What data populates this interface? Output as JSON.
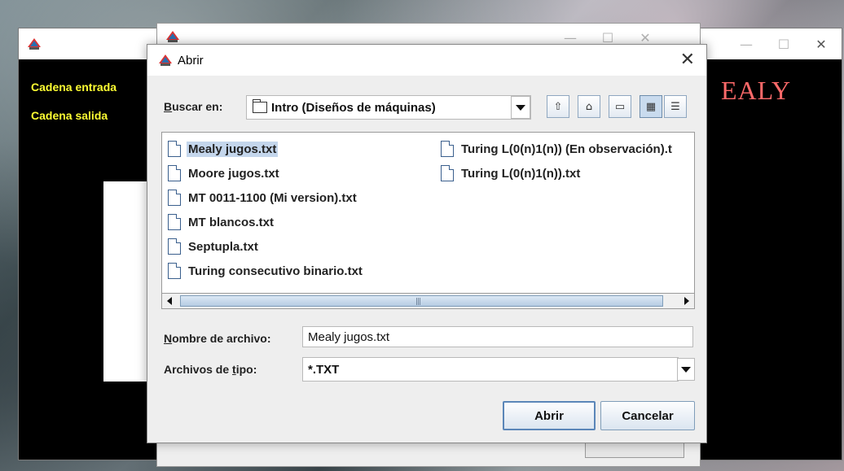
{
  "back_window": {
    "labels": {
      "input_string": "Cadena entrada",
      "output_string": "Cadena salida"
    },
    "title_art": "EALY",
    "controls": {
      "minimize": "—",
      "maximize": "☐",
      "close": "✕"
    }
  },
  "middle_window": {
    "controls": {
      "minimize": "—",
      "maximize": "☐",
      "close": "✕"
    }
  },
  "dialog": {
    "title": "Abrir",
    "close": "✕",
    "look_in": {
      "label_first": "B",
      "label_rest": "uscar en:",
      "value": "Intro (Diseños de máquinas)"
    },
    "toolbar": [
      "up-folder-icon",
      "home-icon",
      "new-folder-icon",
      "list-view-icon",
      "details-view-icon"
    ],
    "files_col1": [
      "Mealy jugos.txt",
      "Moore jugos.txt",
      "MT 0011-1100 (Mi version).txt",
      "MT blancos.txt",
      "Septupla.txt",
      "Turing consecutivo binario.txt"
    ],
    "files_col2": [
      "Turing L(0(n)1(n)) (En observación).t",
      "Turing L(0(n)1(n)).txt"
    ],
    "selected_file": "Mealy jugos.txt",
    "file_name": {
      "label_first": "N",
      "label_rest": "ombre de archivo:",
      "value": "Mealy jugos.txt"
    },
    "file_type": {
      "label_pre": "Archivos de ",
      "label_u": "t",
      "label_post": "ipo:",
      "value": "*.TXT"
    },
    "buttons": {
      "open": "Abrir",
      "cancel": "Cancelar"
    }
  }
}
